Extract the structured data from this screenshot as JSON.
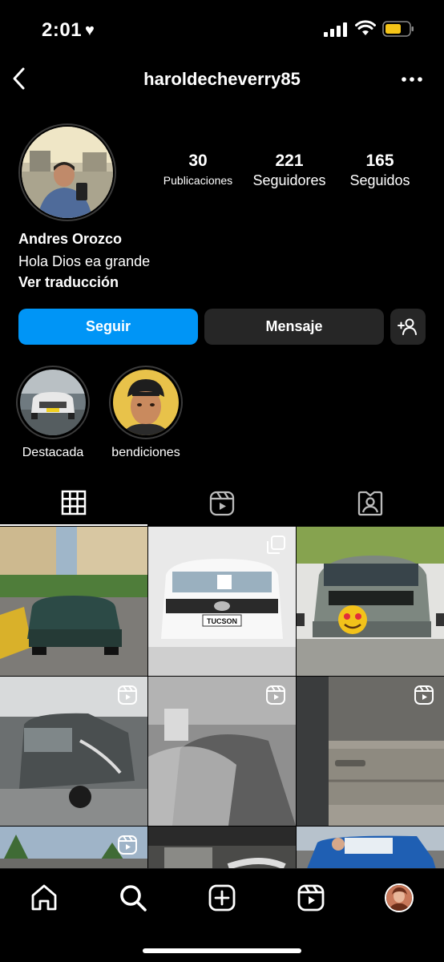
{
  "status_bar": {
    "time": "2:01",
    "heart_icon": "heart-icon",
    "battery_color": "#f5c518"
  },
  "header": {
    "username": "haroldecheverry85"
  },
  "profile": {
    "stats": [
      {
        "value": "30",
        "label": "Publicaciones"
      },
      {
        "value": "221",
        "label": "Seguidores"
      },
      {
        "value": "165",
        "label": "Seguidos"
      }
    ],
    "name": "Andres Orozco",
    "bio": "Hola Dios ea grande",
    "translate_label": "Ver traducción"
  },
  "actions": {
    "follow_label": "Seguir",
    "message_label": "Mensaje",
    "follow_color": "#0095f6"
  },
  "highlights": [
    {
      "label": "Destacada"
    },
    {
      "label": "bendiciones"
    }
  ],
  "tabs": [
    {
      "icon": "grid-icon"
    },
    {
      "icon": "reels-icon"
    },
    {
      "icon": "tagged-icon"
    }
  ],
  "posts": [
    {
      "subject": "green sedan",
      "type": "photo"
    },
    {
      "subject": "white SUV",
      "type": "carousel",
      "plate_text": "TUCSON"
    },
    {
      "subject": "grey SUV",
      "type": "photo"
    },
    {
      "subject": "damaged truck",
      "type": "reel"
    },
    {
      "subject": "painting car",
      "type": "reel"
    },
    {
      "subject": "car door",
      "type": "reel"
    },
    {
      "subject": "street",
      "type": "reel"
    },
    {
      "subject": "garage",
      "type": "photo"
    },
    {
      "subject": "blue jeep",
      "type": "photo"
    }
  ],
  "nav": [
    "home-icon",
    "search-icon",
    "create-icon",
    "reels-icon",
    "profile-avatar"
  ]
}
